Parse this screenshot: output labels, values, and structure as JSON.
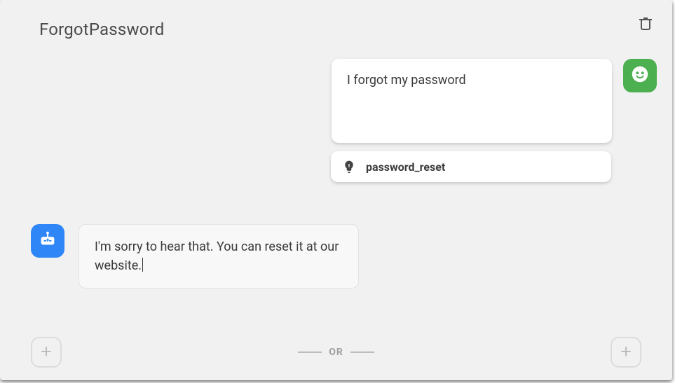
{
  "header": {
    "title": "ForgotPassword"
  },
  "user_message": {
    "text": "I forgot my password"
  },
  "intent": {
    "name": "password_reset"
  },
  "bot_message": {
    "text": "I'm sorry to hear that. You can reset it at our website."
  },
  "separator": {
    "label": "OR"
  }
}
